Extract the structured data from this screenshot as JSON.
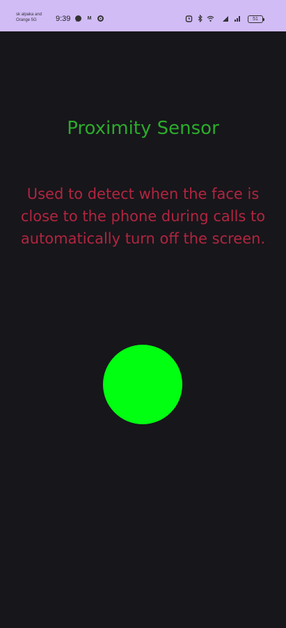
{
  "status_bar": {
    "carrier_line1": "sk alpaka and",
    "carrier_line2": "Orange 5G",
    "time": "9:39",
    "badge_text": "M",
    "battery_level": "51"
  },
  "main": {
    "title": "Proximity Sensor",
    "description": "Used to detect when the face is close to the phone during calls to automatically turn off the screen."
  },
  "indicator": {
    "color": "#00ff11",
    "state": "far"
  },
  "icons": {
    "whatsapp": "whatsapp-icon",
    "gmail": "gmail-icon",
    "settings": "gear-icon",
    "alarm": "alarm-icon",
    "bluetooth": "bluetooth-icon",
    "wifi": "wifi-icon",
    "sim": "sim-icon",
    "signal": "signal-icon",
    "battery": "battery-icon"
  },
  "colors": {
    "background": "#17161b",
    "status_bar": "#d1bcf6",
    "title": "#2cab2b",
    "description": "#b2253f"
  }
}
